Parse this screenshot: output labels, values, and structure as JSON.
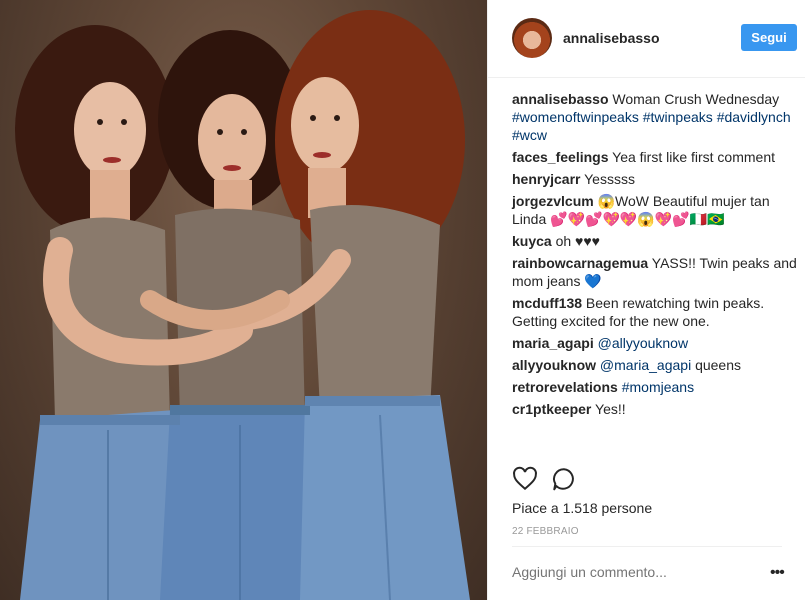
{
  "post": {
    "username": "annalisebasso",
    "follow_label": "Segui",
    "caption": {
      "user": "annalisebasso",
      "text": "Woman Crush Wednesday",
      "hashtags": [
        "#womenoftwinpeaks",
        "#twinpeaks",
        "#davidlynch",
        "#wcw"
      ]
    },
    "comments": [
      {
        "user": "faces_feelings",
        "text": "Yea first like first comment",
        "tag": ""
      },
      {
        "user": "henryjcarr",
        "text": "Yesssss",
        "tag": ""
      },
      {
        "user": "jorgezvlcum",
        "text": "😱WoW Beautiful mujer tan Linda 💕💖💕💖💖😱💖💕🇮🇹🇧🇷",
        "tag": ""
      },
      {
        "user": "kuyca",
        "text": "oh ♥♥♥",
        "tag": ""
      },
      {
        "user": "rainbowcarnagemua",
        "text": "YASS!! Twin peaks and mom jeans 💙",
        "tag": ""
      },
      {
        "user": "mcduff138",
        "text": "Been rewatching twin peaks. Getting excited for the new one.",
        "tag": ""
      },
      {
        "user": "maria_agapi",
        "text": "",
        "tag": "@allyyouknow"
      },
      {
        "user": "allyyouknow",
        "text": "queens",
        "tag": "@maria_agapi"
      },
      {
        "user": "retrorevelations",
        "text": "",
        "tag": "#momjeans"
      },
      {
        "user": "cr1ptkeeper",
        "text": "Yes!!",
        "tag": ""
      }
    ],
    "likes_text": "Piace a 1.518 persone",
    "date": "22 FEBBRAIO",
    "add_comment_placeholder": "Aggiungi un commento...",
    "more_label": "•••",
    "colors": {
      "accent": "#3897f0",
      "link": "#003569",
      "muted": "#999999"
    }
  }
}
